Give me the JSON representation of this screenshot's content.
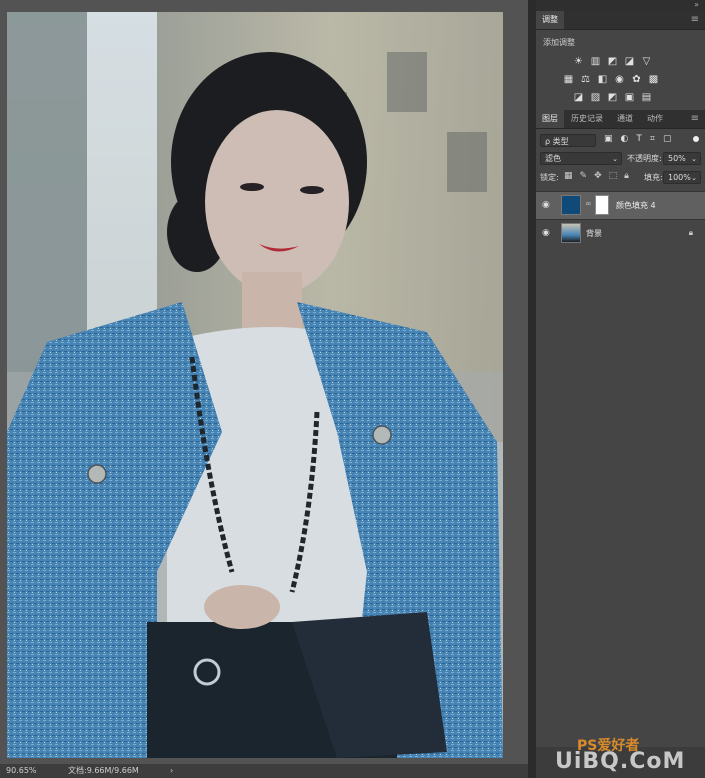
{
  "status": {
    "zoom": "90.65%",
    "doc": "文档:9.66M/9.66M",
    "arrow": "›"
  },
  "adjust_panel": {
    "tab": "调整",
    "title": "添加调整"
  },
  "layers_panel": {
    "tabs": [
      "图层",
      "历史记录",
      "通道",
      "动作"
    ],
    "kind_filter": "ρ 类型",
    "blend_mode": "滤色",
    "opacity_label": "不透明度:",
    "opacity_value": "50%",
    "lock_label": "锁定:",
    "fill_label": "填充:",
    "fill_value": "100%",
    "layers": [
      {
        "name": "颜色填充 4",
        "selected": true,
        "thumb_color": "#0f4a78"
      },
      {
        "name": "背景",
        "selected": false,
        "locked": true
      }
    ]
  },
  "watermark": {
    "ps": "PS爱好者",
    "site": "UiBQ.CoM"
  },
  "icons": {
    "menu": "hamburger-menu-icon",
    "eye": "eye-icon",
    "lock": "lock-icon",
    "chain": "chain-link-icon"
  },
  "colors": {
    "fill_layer": "#0f4a78",
    "jacket": "#4a86b8",
    "panel": "#454545"
  }
}
